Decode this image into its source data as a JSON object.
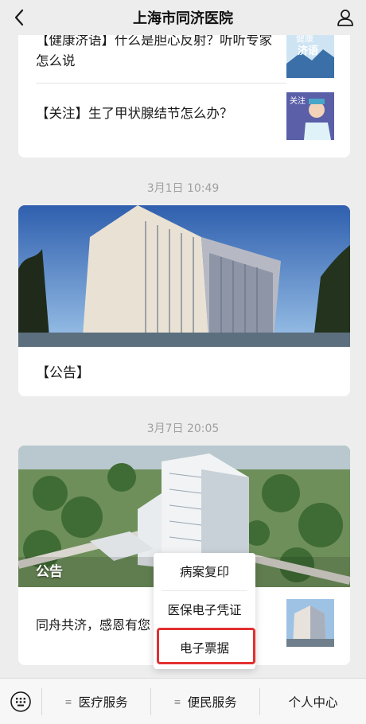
{
  "header": {
    "title": "上海市同济医院"
  },
  "feed": {
    "card1": {
      "items": [
        {
          "title": "【健康济语】什么是胆心反射？听听专家怎么说",
          "thumb_text_top": "健康",
          "thumb_text_bottom": "济语"
        },
        {
          "title": "【关注】生了甲状腺结节怎么办？",
          "thumb_text": "关注"
        }
      ]
    },
    "timestamp1": "3月1日 10:49",
    "card2": {
      "caption": "【公告】"
    },
    "timestamp2": "3月7日 20:05",
    "card3": {
      "overlay_label": "公告",
      "body_text": "同舟共济，感恩有您"
    }
  },
  "popup_menu": {
    "items": [
      "病案复印",
      "医保电子凭证",
      "电子票据"
    ],
    "highlighted_index": 2,
    "highlight_color": "#e33030"
  },
  "bottom_nav": {
    "tabs": [
      "医疗服务",
      "便民服务",
      "个人中心"
    ],
    "menu_glyph": "≡"
  },
  "colors": {
    "background": "#ededed",
    "card": "#ffffff",
    "timestamp": "#a0a0a0"
  }
}
